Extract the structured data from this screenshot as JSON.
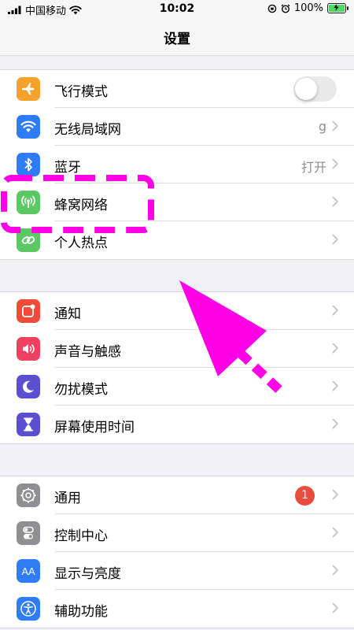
{
  "status_bar": {
    "carrier": "中国移动",
    "time": "10:02",
    "battery_percent": "100%"
  },
  "nav": {
    "title": "设置"
  },
  "groups": [
    {
      "items": [
        {
          "label": "飞行模式",
          "icon": "airplane-icon",
          "color": "#f7a12d",
          "toggle_on": false
        },
        {
          "label": "无线局域网",
          "icon": "wifi-icon",
          "color": "#2e7cf6",
          "value": "g"
        },
        {
          "label": "蓝牙",
          "icon": "bluetooth-icon",
          "color": "#2e7cf6",
          "value": "打开"
        },
        {
          "label": "蜂窝网络",
          "icon": "cellular-antenna-icon",
          "color": "#5cc864"
        },
        {
          "label": "个人热点",
          "icon": "hotspot-link-icon",
          "color": "#5cc864"
        }
      ]
    },
    {
      "items": [
        {
          "label": "通知",
          "icon": "notifications-icon",
          "color": "#ee4b3b"
        },
        {
          "label": "声音与触感",
          "icon": "speaker-icon",
          "color": "#ee4160"
        },
        {
          "label": "勿扰模式",
          "icon": "moon-icon",
          "color": "#5a4fd1"
        },
        {
          "label": "屏幕使用时间",
          "icon": "hourglass-icon",
          "color": "#5a4fd1"
        }
      ]
    },
    {
      "items": [
        {
          "label": "通用",
          "icon": "gear-icon",
          "color": "#8e8e93",
          "badge": "1"
        },
        {
          "label": "控制中心",
          "icon": "control-center-icon",
          "color": "#8e8e93"
        },
        {
          "label": "显示与亮度",
          "icon": "display-aa-icon",
          "color": "#2e7cf6",
          "icon_text": "AA"
        },
        {
          "label": "辅助功能",
          "icon": "accessibility-icon",
          "color": "#2e7cf6"
        }
      ]
    }
  ],
  "annotation_color": "#ff00e6"
}
